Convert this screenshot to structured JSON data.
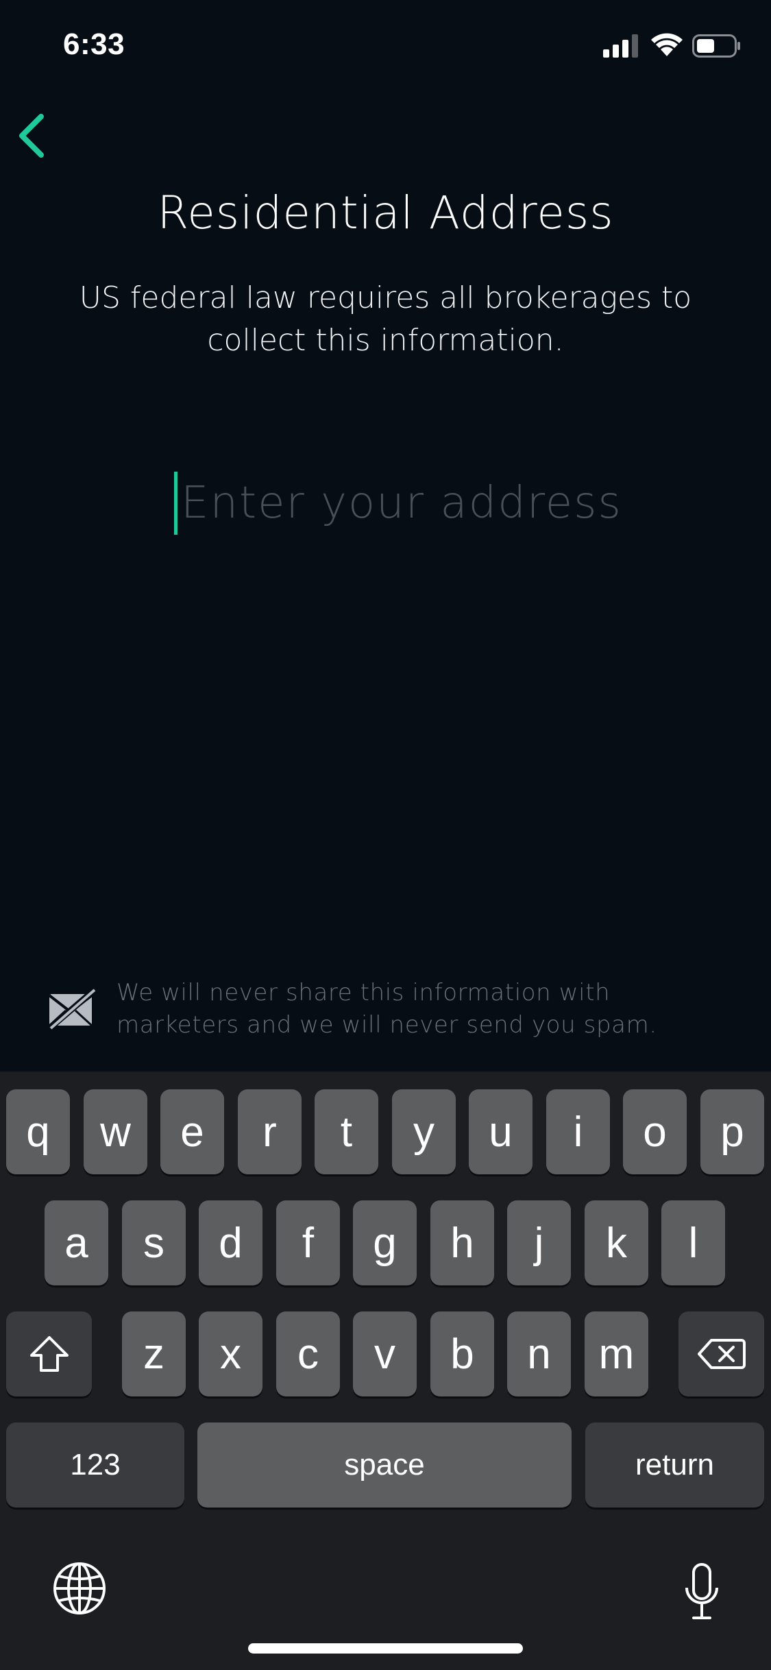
{
  "status_bar": {
    "time": "6:33"
  },
  "header": {
    "title": "Residential Address",
    "subtitle": "US federal law requires all brokerages to collect this information."
  },
  "address_field": {
    "value": "",
    "placeholder": "Enter your address"
  },
  "privacy": {
    "note": "We will never share this information with marketers and we will never send you spam."
  },
  "colors": {
    "accent": "#20c99a",
    "background": "#070d14",
    "keyboard": "#1c1e21"
  },
  "keyboard": {
    "row1": [
      "q",
      "w",
      "e",
      "r",
      "t",
      "y",
      "u",
      "i",
      "o",
      "p"
    ],
    "row2": [
      "a",
      "s",
      "d",
      "f",
      "g",
      "h",
      "j",
      "k",
      "l"
    ],
    "row3": [
      "z",
      "x",
      "c",
      "v",
      "b",
      "n",
      "m"
    ],
    "numbers_label": "123",
    "space_label": "space",
    "return_label": "return"
  }
}
